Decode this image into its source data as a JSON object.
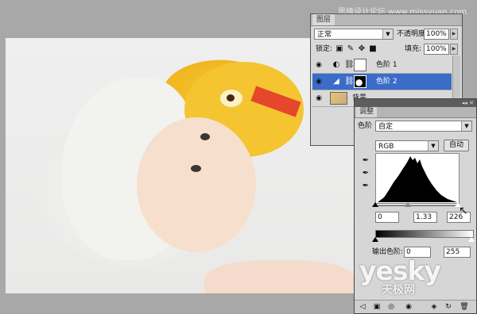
{
  "watermark": {
    "top_text": "思缘设计论坛 www.missyuan.com",
    "logo": "yesky",
    "sub": "天极网"
  },
  "layers_panel": {
    "tab": "图层",
    "blend_mode": "正常",
    "opacity_label": "不透明度:",
    "opacity_value": "100%",
    "lock_label": "锁定:",
    "fill_label": "填充:",
    "fill_value": "100%",
    "layers": [
      {
        "name": "色阶 1",
        "selected": false
      },
      {
        "name": "色阶 2",
        "selected": true
      },
      {
        "name": "背景",
        "selected": false
      }
    ]
  },
  "adjustments_panel": {
    "tab": "调整",
    "type_label": "色阶",
    "preset_value": "自定",
    "channel_value": "RGB",
    "auto_button": "自动",
    "input_black": "0",
    "input_gamma": "1.33",
    "input_white": "226",
    "output_label": "输出色阶:",
    "output_black": "0",
    "output_white": "255"
  },
  "colors": {
    "selected_row": "#3a6cc8",
    "panel_bg": "#d9d9d9"
  }
}
